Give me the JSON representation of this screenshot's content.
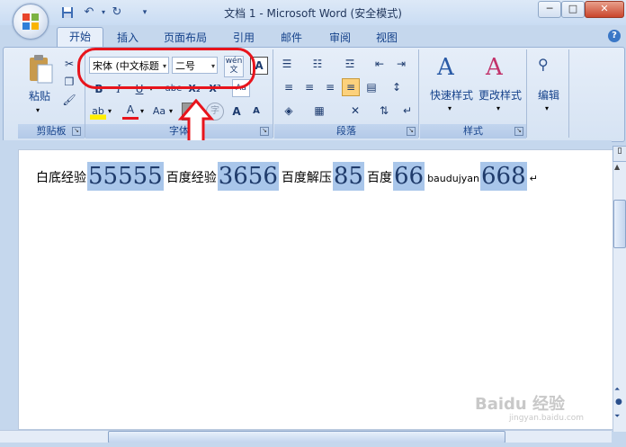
{
  "window": {
    "title": "文档 1 - Microsoft Word (安全模式)",
    "min_label": "─",
    "max_label": "□",
    "close_label": "✕"
  },
  "quick_access": {
    "save_icon": "save-icon",
    "undo_icon": "undo-icon",
    "redo_icon": "redo-icon",
    "more": "▾"
  },
  "tabs": [
    {
      "label": "开始"
    },
    {
      "label": "插入"
    },
    {
      "label": "页面布局"
    },
    {
      "label": "引用"
    },
    {
      "label": "邮件"
    },
    {
      "label": "审阅"
    },
    {
      "label": "视图"
    }
  ],
  "help": "?",
  "clipboard": {
    "paste_label": "粘贴",
    "group_label": "剪贴板"
  },
  "font": {
    "font_name": "宋体 (中文标题",
    "font_size": "二号",
    "phonetic": "wén 文",
    "group_label": "字体",
    "bold": "B",
    "italic": "I",
    "underline": "U",
    "strike": "abe",
    "subscript": "X₂",
    "superscript": "X²",
    "highlight": "ab",
    "color": "A",
    "case": "Aa",
    "shade": "A",
    "enclose": "字",
    "grow": "A",
    "shrink": "A"
  },
  "paragraph": {
    "group_label": "段落"
  },
  "styles": {
    "quick_label": "快速样式",
    "change_label": "更改样式",
    "group_label": "样式"
  },
  "editing": {
    "label": "编辑"
  },
  "document": {
    "segments": [
      {
        "text": "白底经验",
        "type": "sm"
      },
      {
        "text": "55555",
        "type": "big"
      },
      {
        "text": "百度经验",
        "type": "sm"
      },
      {
        "text": "3656",
        "type": "big"
      },
      {
        "text": "百度解压",
        "type": "sm"
      },
      {
        "text": "85",
        "type": "big"
      },
      {
        "text": "百度",
        "type": "sm"
      },
      {
        "text": "66",
        "type": "big"
      },
      {
        "text": "baudujyan",
        "type": "tiny"
      },
      {
        "text": "668",
        "type": "big"
      },
      {
        "text": "↵",
        "type": "tiny"
      }
    ]
  },
  "watermark": {
    "brand": "Baidu 经验",
    "url": "jingyan.baidu.com"
  },
  "colors": {
    "annotation": "#e8141c",
    "highlight": "#a9c6ea"
  }
}
